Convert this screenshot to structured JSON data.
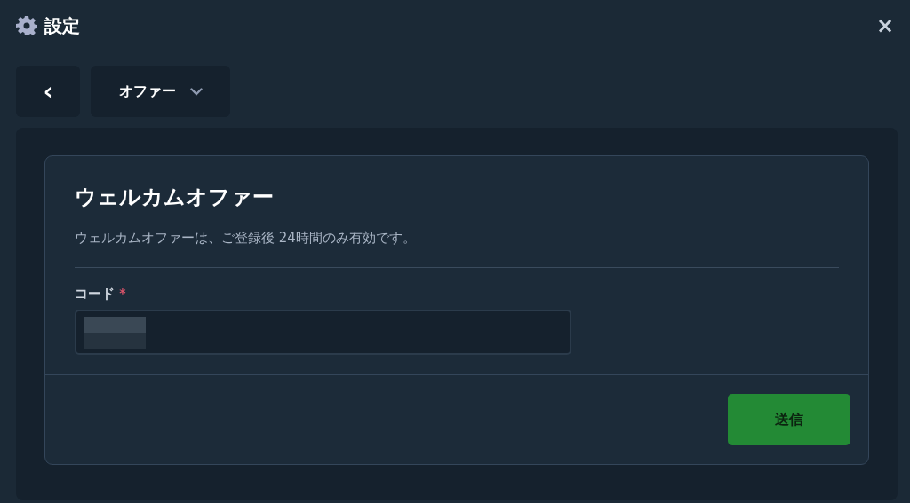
{
  "window": {
    "title": "設定",
    "close": "×"
  },
  "nav": {
    "back": "‹",
    "menu": "オファー"
  },
  "card": {
    "title": "ウェルカムオファー",
    "description": "ウェルカムオファーは、ご登録後 24時間のみ有効です。",
    "field": {
      "label": "コード",
      "required_mark": "*",
      "redacted": true
    },
    "submit": "送信"
  }
}
